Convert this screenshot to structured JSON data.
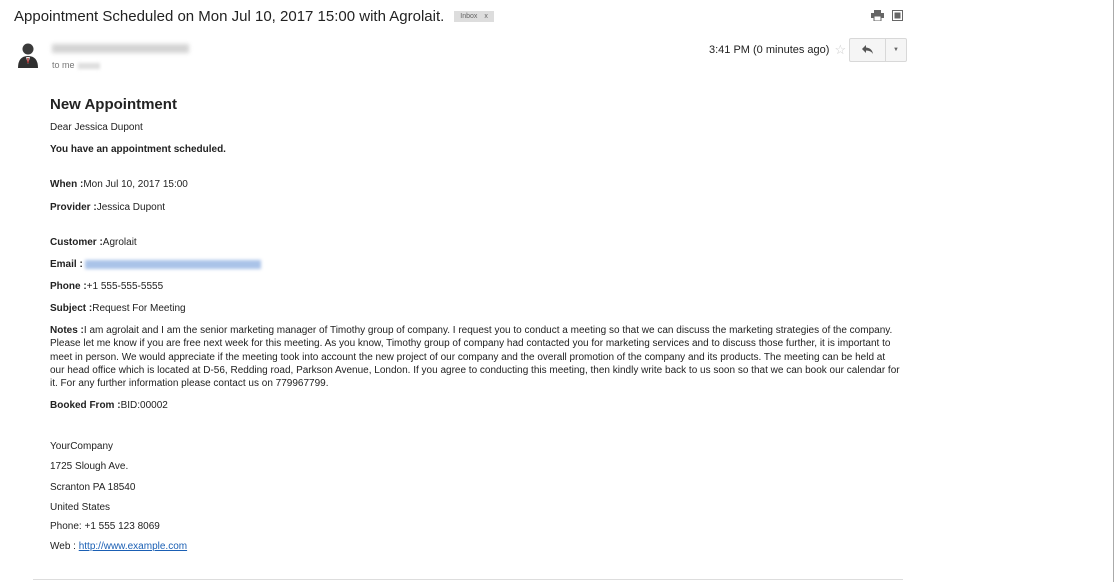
{
  "subject": {
    "title": "Appointment Scheduled on Mon Jul 10, 2017 15:00 with Agrolait.",
    "label": "Inbox",
    "label_close": "x"
  },
  "header": {
    "to": "to me",
    "time": "3:41 PM (0 minutes ago)"
  },
  "icons": {
    "print": "print-icon",
    "new_window": "new-window-icon",
    "star": "star-icon",
    "reply": "reply-icon",
    "more": "more-options-icon",
    "avatar": "avatar"
  },
  "body": {
    "heading": "New Appointment",
    "greeting": "Dear Jessica Dupont",
    "intro": "You have an appointment scheduled.",
    "when_label": "When :",
    "when_value": "Mon Jul 10, 2017 15:00",
    "provider_label": "Provider :",
    "provider_value": "Jessica Dupont",
    "customer_label": "Customer :",
    "customer_value": "Agrolait",
    "email_label": "Email :",
    "phone_label": "Phone :",
    "phone_value": "+1 555-555-5555",
    "subject_label": "Subject :",
    "subject_value": "Request For Meeting",
    "notes_label": "Notes :",
    "notes_value": "I am agrolait and I am the senior marketing manager of Timothy group of company. I request you to conduct a meeting so that we can discuss the marketing strategies of the company. Please let me know if you are free next week for this meeting. As you know, Timothy group of company had contacted you for marketing services and to discuss those further, it is important to meet in person. We would appreciate if the meeting took into account the new project of our company and the overall promotion of the company and its products. The meeting can be held at our head office which is located at D-56, Redding road, Parkson Avenue, London. If you agree to conducting this meeting, then kindly write back to us soon so that we can book our calendar for it. For any further information please contact us on 779967799.",
    "booked_label": "Booked From :",
    "booked_value": "BID:00002"
  },
  "signature": {
    "company": "YourCompany",
    "street": "1725 Slough Ave.",
    "city": "Scranton PA 18540",
    "country": "United States",
    "phone": "Phone: +1 555 123 8069",
    "web_label": "Web : ",
    "web_link": "http://www.example.com"
  }
}
